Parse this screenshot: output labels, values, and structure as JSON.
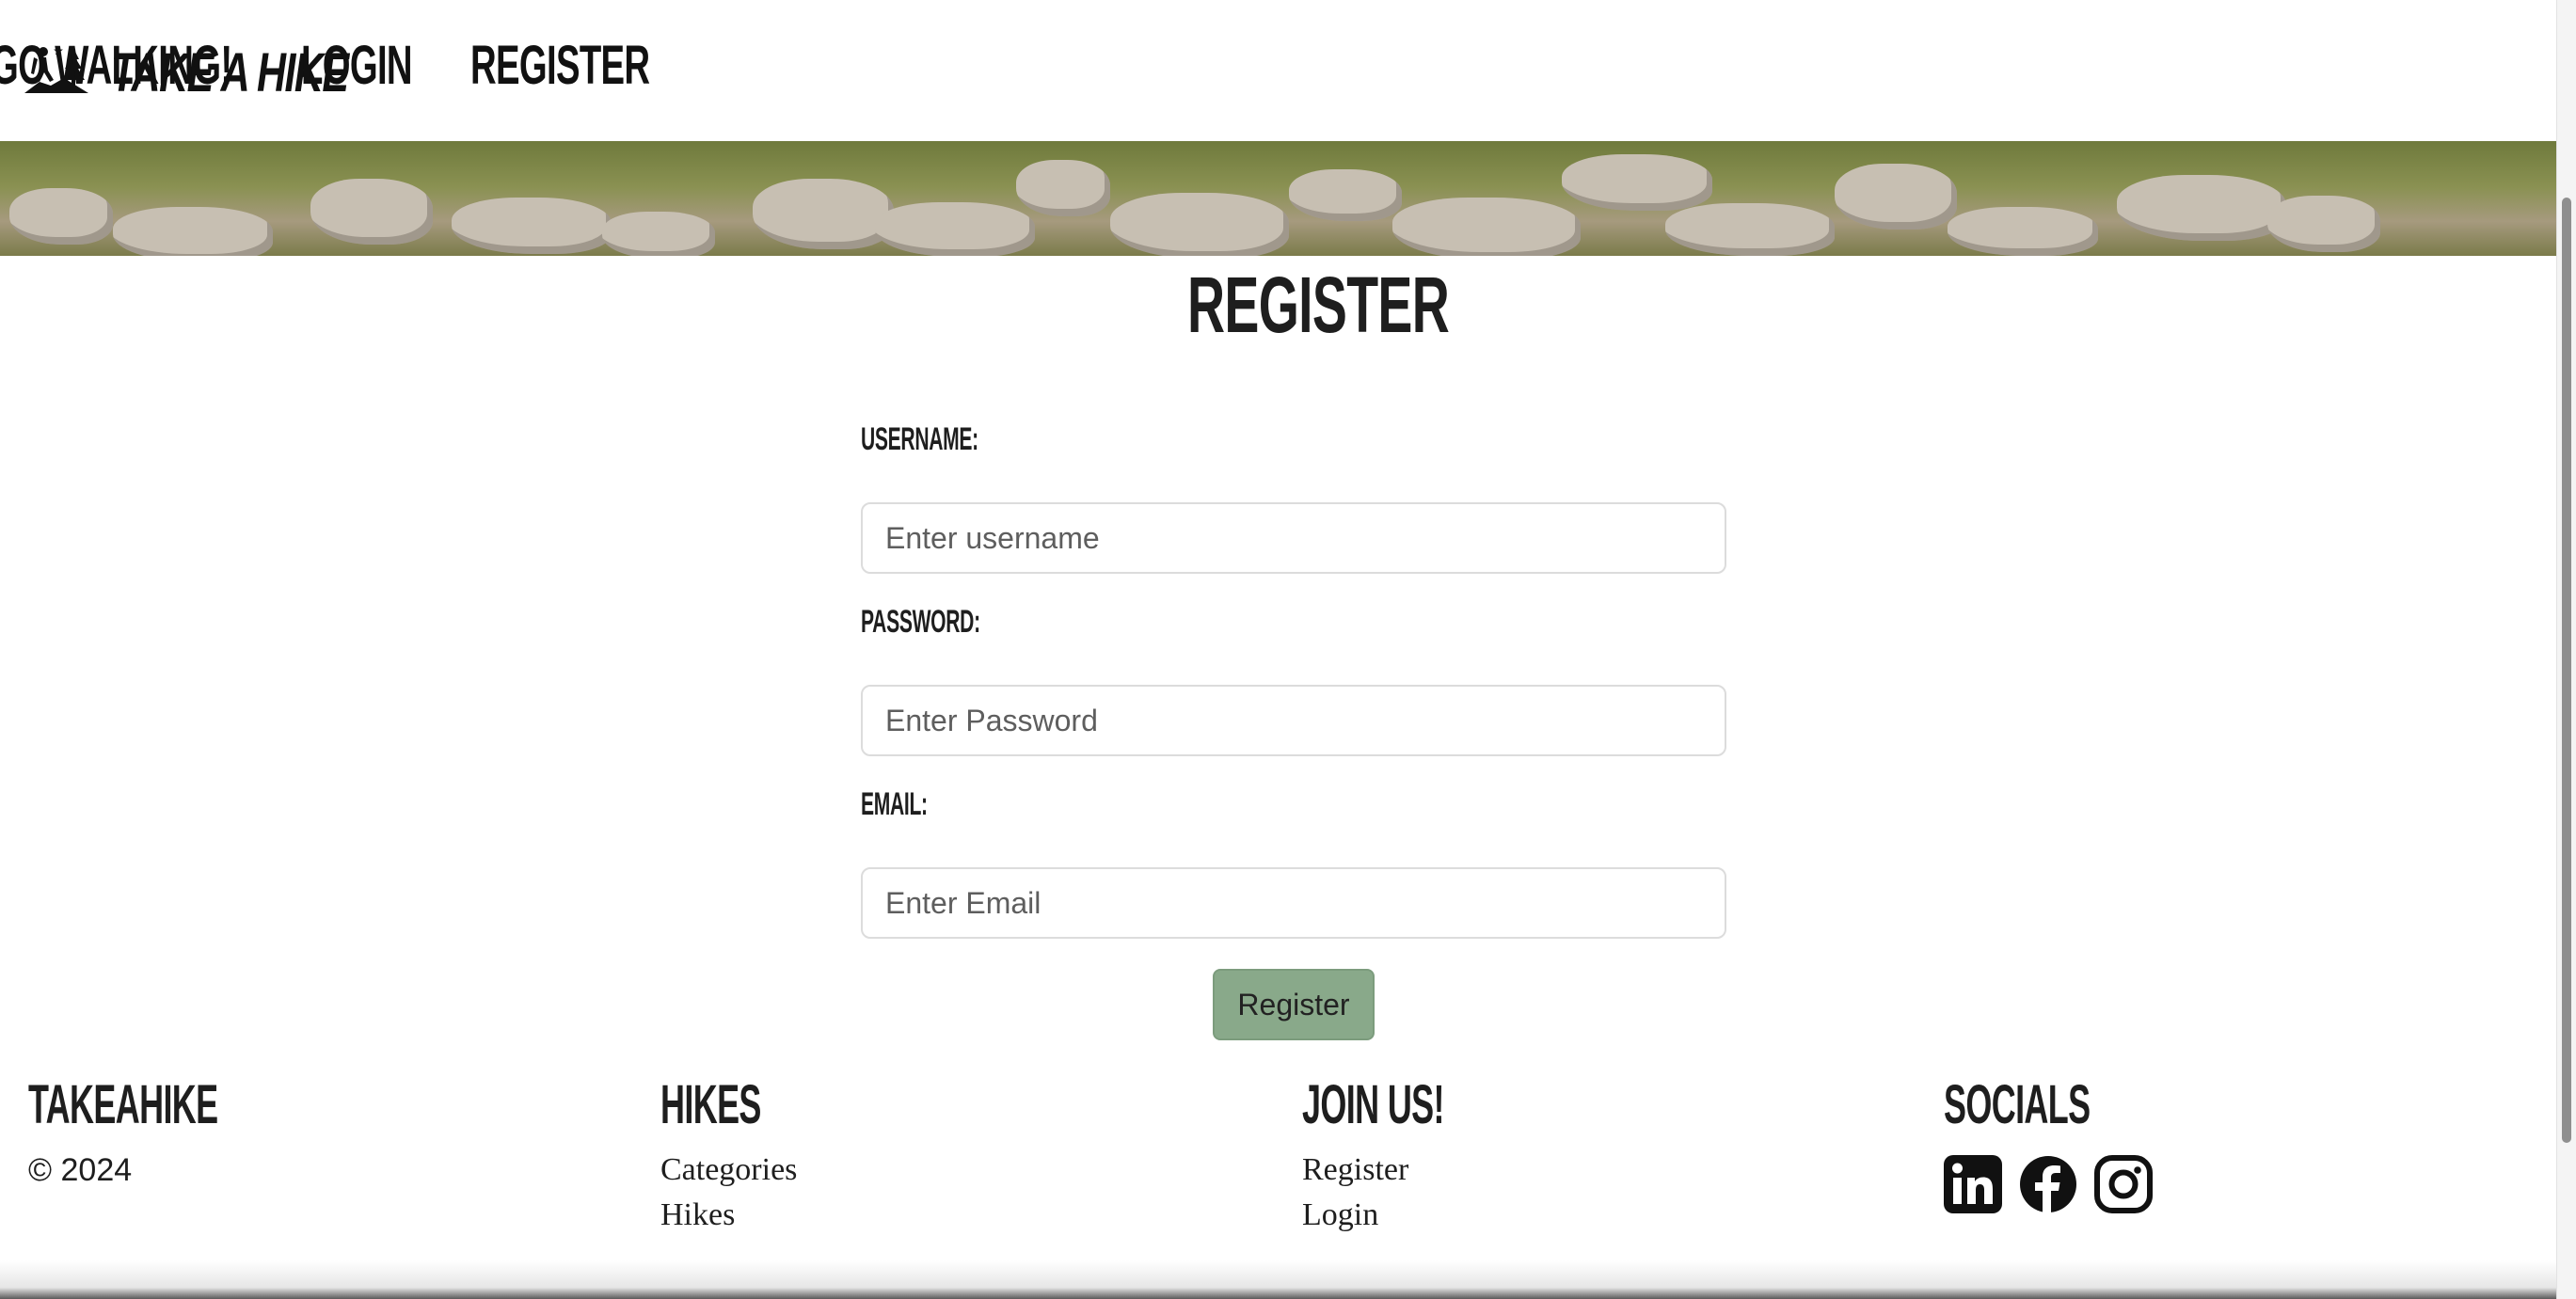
{
  "nav": {
    "brand": "TAKE A HIKE",
    "links": [
      "GO WALKING!",
      "LOGIN",
      "REGISTER"
    ]
  },
  "page": {
    "title": "REGISTER"
  },
  "form": {
    "username_label": "USERNAME:",
    "username_placeholder": "Enter username",
    "password_label": "PASSWORD:",
    "password_placeholder": "Enter Password",
    "email_label": "EMAIL:",
    "email_placeholder": "Enter Email",
    "submit_label": "Register"
  },
  "footer": {
    "brand_heading": "TAKEAHIKE",
    "copyright": "© 2024",
    "hikes_heading": "HIKES",
    "hikes_links": [
      "Categories",
      "Hikes"
    ],
    "join_heading": "JOIN US!",
    "join_links": [
      "Register",
      "Login"
    ],
    "socials_heading": "SOCIALS",
    "social_icons": [
      "linkedin-icon",
      "facebook-icon",
      "instagram-icon"
    ]
  },
  "colors": {
    "accent_button": "#89a98a",
    "text": "#1e1e1e"
  }
}
